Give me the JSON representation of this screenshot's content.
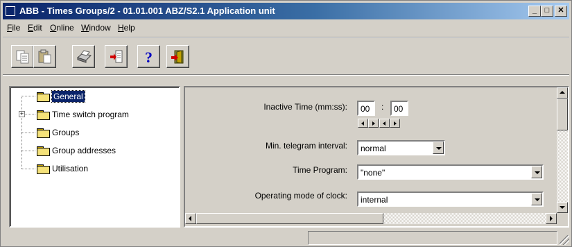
{
  "window": {
    "title": "ABB - Times Groups/2 - 01.01.001 ABZ/S2.1 Application unit",
    "controls": {
      "minimize": "_",
      "maximize": "□",
      "close": "✕"
    }
  },
  "menu": [
    "File",
    "Edit",
    "Online",
    "Window",
    "Help"
  ],
  "toolbar": [
    {
      "name": "copy-button",
      "icon": "copy-icon"
    },
    {
      "name": "paste-button",
      "icon": "paste-icon"
    },
    {
      "name": "print-button",
      "icon": "printer-icon"
    },
    {
      "name": "import-button",
      "icon": "import-icon"
    },
    {
      "name": "help-button",
      "icon": "question-mark-icon"
    },
    {
      "name": "exit-button",
      "icon": "exit-door-icon"
    }
  ],
  "tree": {
    "items": [
      {
        "label": "General",
        "selected": true,
        "expandable": false
      },
      {
        "label": "Time switch program",
        "selected": false,
        "expandable": true,
        "expander": "+"
      },
      {
        "label": "Groups",
        "selected": false,
        "expandable": false
      },
      {
        "label": "Group addresses",
        "selected": false,
        "expandable": false
      },
      {
        "label": "Utilisation",
        "selected": false,
        "expandable": false
      }
    ]
  },
  "params": {
    "inactive_time": {
      "label": "Inactive Time (mm:ss):",
      "minutes": "00",
      "separator": ":",
      "seconds": "00"
    },
    "min_telegram": {
      "label": "Min. telegram interval:",
      "value": "normal"
    },
    "time_program": {
      "label": "Time Program:",
      "value": "\"none\""
    },
    "operating_mode": {
      "label": "Operating mode of clock:",
      "value": "internal"
    }
  },
  "status": {
    "left": "",
    "right": ""
  },
  "colors": {
    "titlebar_start": "#0a246a",
    "titlebar_end": "#a6caf0",
    "face": "#d4d0c8",
    "selection": "#0a246a"
  }
}
